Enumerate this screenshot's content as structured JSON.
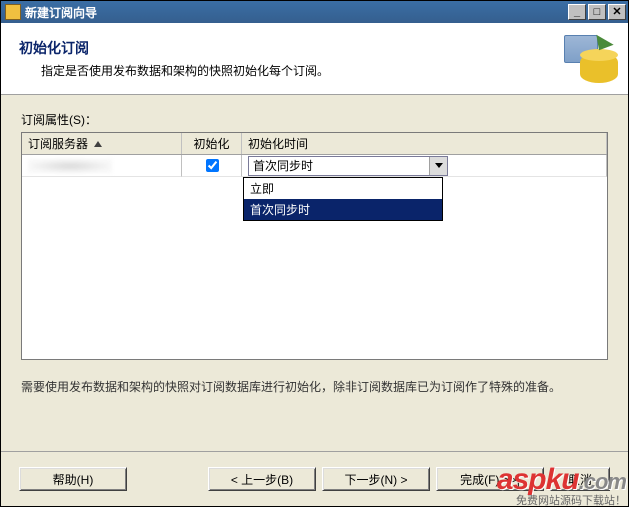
{
  "titlebar": {
    "title": "新建订阅向导"
  },
  "header": {
    "title": "初始化订阅",
    "subtitle": "指定是否使用发布数据和架构的快照初始化每个订阅。"
  },
  "body": {
    "properties_label": "订阅属性(S)：",
    "columns": {
      "server": "订阅服务器",
      "init": "初始化",
      "init_time": "初始化时间"
    },
    "row": {
      "init_checked": true,
      "init_time_selected": "首次同步时"
    },
    "dropdown": {
      "options": [
        "立即",
        "首次同步时"
      ],
      "selected_index": 1
    },
    "hint": "需要使用发布数据和架构的快照对订阅数据库进行初始化，除非订阅数据库已为订阅作了特殊的准备。"
  },
  "footer": {
    "help": "帮助(H)",
    "back": "< 上一步(B)",
    "next": "下一步(N) >",
    "finish": "完成(F) >>|",
    "cancel": "取消"
  },
  "watermark": {
    "brand_html": "aspku",
    "domain": ".com",
    "sub": "免费网站源码下载站！"
  }
}
